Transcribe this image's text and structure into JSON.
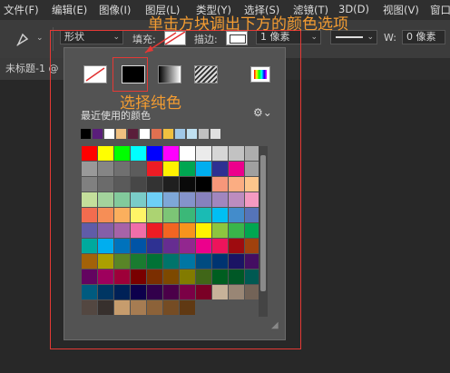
{
  "menu": [
    "文件(F)",
    "编辑(E)",
    "图像(I)",
    "图层(L)",
    "类型(Y)",
    "选择(S)",
    "滤镜(T)",
    "3D(D)",
    "视图(V)",
    "窗口"
  ],
  "options": {
    "shape_mode": "形状",
    "fill_label": "填充:",
    "stroke_label": "描边:",
    "stroke_width": "1 像素",
    "w_label": "W:",
    "w_value": "0 像素"
  },
  "document_tab": "未标题-1 @",
  "annotations": {
    "top": "单击方块调出下方的颜色选项",
    "middle": "选择纯色"
  },
  "panel": {
    "recent_label": "最近使用的颜色",
    "fill_types": [
      "no-color",
      "solid-color",
      "gradient",
      "pattern"
    ],
    "recent_colors": [
      "#000000",
      "#5a1e7a",
      "#ffffff",
      "#f0c080",
      "#5a1e3a",
      "#ffffff",
      "#e07050",
      "#f0c040",
      "#a0c8e8",
      "#c0e0f0",
      "#c0c0c0",
      "#e0e0e0"
    ],
    "grid": [
      [
        "#ff0000",
        "#ffff00",
        "#00ff00",
        "#00ffff",
        "#0000ff",
        "#ff00ff",
        "#ffffff",
        "#ebebeb",
        "#d6d6d6",
        "#c2c2c2",
        "#adadad"
      ],
      [
        "#999999",
        "#858585",
        "#707070",
        "#5c5c5c",
        "#ed1c24",
        "#fff200",
        "#00a651",
        "#00aeef",
        "#2e3192",
        "#ec008c",
        "#a0a0a0"
      ],
      [
        "#808080",
        "#6b6b6b",
        "#5a5a5a",
        "#474747",
        "#333333",
        "#1f1f1f",
        "#0a0a0a",
        "#000000",
        "#f7977a",
        "#fbad82",
        "#fdc68c"
      ],
      [
        "#c4df9b",
        "#a3d39c",
        "#82ca9c",
        "#7accc8",
        "#6dcff6",
        "#7ea7d8",
        "#8493ca",
        "#8781bd",
        "#a186be",
        "#bd8cbf",
        "#f49ac1"
      ],
      [
        "#f26c4f",
        "#f68e56",
        "#fbaf5d",
        "#fff467",
        "#acd372",
        "#7cc576",
        "#3bb878",
        "#1abbb4",
        "#00bff3",
        "#438ccb",
        "#5574b9"
      ],
      [
        "#605ca8",
        "#855fa8",
        "#a763a8",
        "#f06ea9",
        "#ed1c24",
        "#f26522",
        "#f7941d",
        "#fff200",
        "#8dc63f",
        "#39b54a",
        "#00a651"
      ],
      [
        "#00a99d",
        "#00aeef",
        "#0072bc",
        "#0054a6",
        "#2e3192",
        "#662d91",
        "#92278f",
        "#ec008c",
        "#ed145b",
        "#9e0b0f",
        "#a0410d"
      ],
      [
        "#a36209",
        "#aba000",
        "#598527",
        "#1a7b30",
        "#007236",
        "#00746b",
        "#0076a3",
        "#004b80",
        "#003471",
        "#1b1464",
        "#440e62"
      ],
      [
        "#630460",
        "#9e005d",
        "#9e0039",
        "#790000",
        "#7b2e00",
        "#7d4900",
        "#827b00",
        "#406618",
        "#005e20",
        "#005826",
        "#005952"
      ],
      [
        "#005b7f",
        "#003663",
        "#002157",
        "#0d004c",
        "#32004b",
        "#4b0049",
        "#7b0046",
        "#7a0026",
        "#c7b299",
        "#998675",
        "#736357"
      ],
      [
        "#534741",
        "#37302d",
        "#c69c6d",
        "#a67c52",
        "#8c6239",
        "#754c24",
        "#603913"
      ]
    ]
  }
}
